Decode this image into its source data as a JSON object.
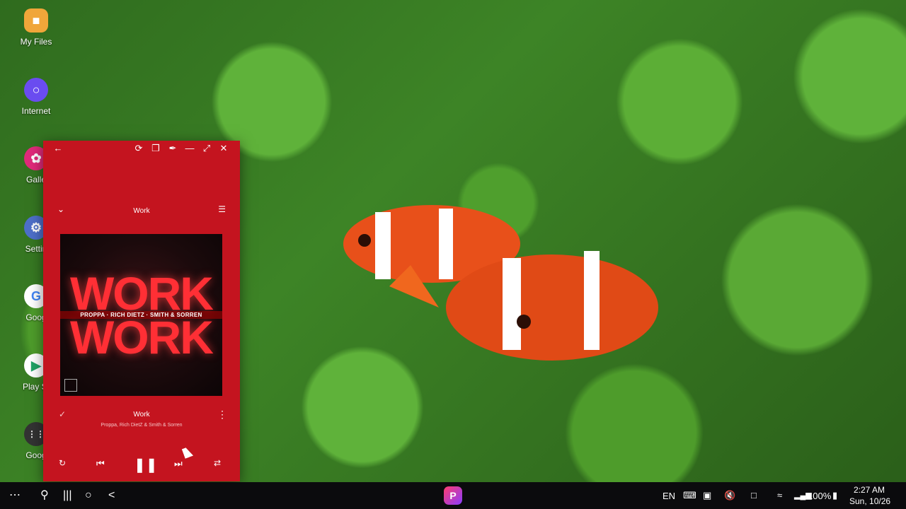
{
  "desktop": {
    "icons": [
      {
        "label": "My Files",
        "icon": "folder-icon",
        "color": "#f0a63a"
      },
      {
        "label": "Internet",
        "icon": "internet-icon",
        "color": "#6a4cf0"
      },
      {
        "label": "Galle",
        "icon": "gallery-icon",
        "color": "#e02a7a"
      },
      {
        "label": "Settin",
        "icon": "settings-icon",
        "color": "#4d6fc9"
      },
      {
        "label": "Goog",
        "icon": "google-icon",
        "color": "#ffffff"
      },
      {
        "label": "Play St",
        "icon": "play-store-icon",
        "color": "#ffffff"
      },
      {
        "label": "Goog",
        "icon": "google-folder-icon",
        "color": "#333333"
      }
    ]
  },
  "window": {
    "accent": "#c4141f",
    "buttons": [
      "back-icon",
      "rotate-icon",
      "copy-icon",
      "pin-icon",
      "minimize-icon",
      "maximize-icon",
      "close-icon"
    ]
  },
  "player": {
    "header_title": "Work",
    "album_big_text": "WORK",
    "album_credits": "PROPPA · RICH DIETZ · SMITH & SORREN",
    "track_title": "Work",
    "track_artist": "Proppa, Rich DietZ & Smith & Sorren"
  },
  "taskbar": {
    "language": "EN",
    "battery": "100%",
    "time": "2:27 AM",
    "date": "Sun, 10/26"
  }
}
